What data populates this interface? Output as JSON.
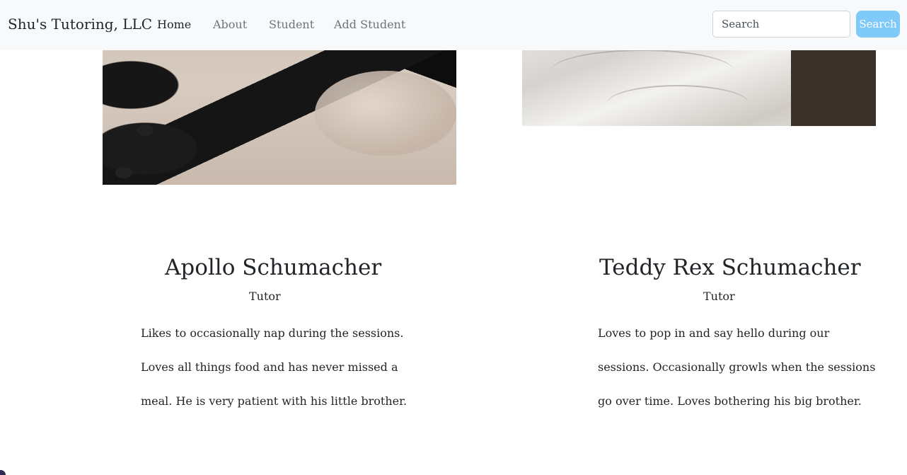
{
  "navbar": {
    "brand": "Shu's Tutoring, LLC",
    "links": [
      "Home",
      "About",
      "Student",
      "Add Student"
    ],
    "active": "Home",
    "search": {
      "placeholder": "Search",
      "button_label": "Search"
    },
    "colors": {
      "background": "#f8f9fa",
      "search_button": "#7fcaf8"
    }
  },
  "profiles": [
    {
      "name": "Apollo Schumacher",
      "role": "Tutor",
      "bio_lines": [
        "Likes to occasionally nap during the sessions.",
        "Loves all things food and has never missed a",
        "meal. He is very patient with his little brother."
      ]
    },
    {
      "name": "Teddy Rex Schumacher",
      "role": "Tutor",
      "bio_lines": [
        "Loves to pop in and say hello during our",
        "sessions. Occasionally growls when the sessions",
        "go over time. Loves bothering his big brother."
      ]
    }
  ]
}
